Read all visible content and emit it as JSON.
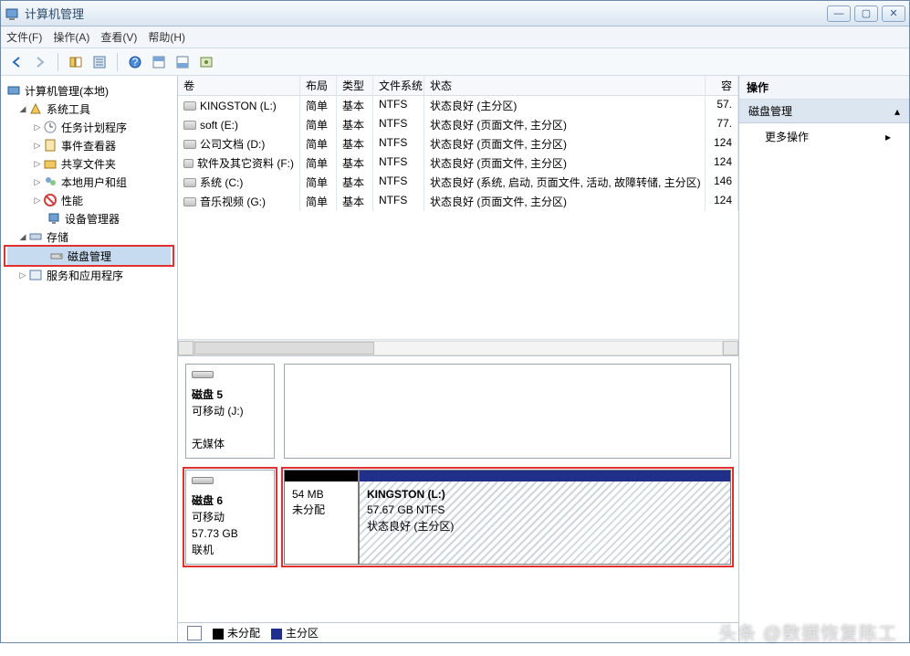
{
  "window": {
    "title": "计算机管理"
  },
  "menu": {
    "file": "文件(F)",
    "action": "操作(A)",
    "view": "查看(V)",
    "help": "帮助(H)"
  },
  "tree": {
    "root": "计算机管理(本地)",
    "system_tools": "系统工具",
    "task_scheduler": "任务计划程序",
    "event_viewer": "事件查看器",
    "shared_folders": "共享文件夹",
    "local_users": "本地用户和组",
    "performance": "性能",
    "device_manager": "设备管理器",
    "storage": "存储",
    "disk_management": "磁盘管理",
    "services": "服务和应用程序"
  },
  "columns": {
    "volume": "卷",
    "layout": "布局",
    "type": "类型",
    "fs": "文件系统",
    "status": "状态",
    "capacity": "容"
  },
  "volumes": [
    {
      "name": "KINGSTON (L:)",
      "layout": "简单",
      "type": "基本",
      "fs": "NTFS",
      "status": "状态良好 (主分区)",
      "cap": "57."
    },
    {
      "name": "soft (E:)",
      "layout": "简单",
      "type": "基本",
      "fs": "NTFS",
      "status": "状态良好 (页面文件, 主分区)",
      "cap": "77."
    },
    {
      "name": "公司文档 (D:)",
      "layout": "简单",
      "type": "基本",
      "fs": "NTFS",
      "status": "状态良好 (页面文件, 主分区)",
      "cap": "124"
    },
    {
      "name": "软件及其它资料 (F:)",
      "layout": "简单",
      "type": "基本",
      "fs": "NTFS",
      "status": "状态良好 (页面文件, 主分区)",
      "cap": "124"
    },
    {
      "name": "系统 (C:)",
      "layout": "简单",
      "type": "基本",
      "fs": "NTFS",
      "status": "状态良好 (系统, 启动, 页面文件, 活动, 故障转储, 主分区)",
      "cap": "146"
    },
    {
      "name": "音乐视频 (G:)",
      "layout": "简单",
      "type": "基本",
      "fs": "NTFS",
      "status": "状态良好 (页面文件, 主分区)",
      "cap": "124"
    }
  ],
  "disk5": {
    "title": "磁盘 5",
    "line1": "可移动 (J:)",
    "line2": "无媒体"
  },
  "disk6": {
    "title": "磁盘 6",
    "line1": "可移动",
    "line2": "57.73 GB",
    "line3": "联机",
    "part1": {
      "size": "54 MB",
      "status": "未分配"
    },
    "part2": {
      "name": "KINGSTON  (L:)",
      "size": "57.67 GB NTFS",
      "status": "状态良好 (主分区)"
    }
  },
  "legend": {
    "unallocated": "未分配",
    "primary": "主分区"
  },
  "actions": {
    "title": "操作",
    "group": "磁盘管理",
    "more": "更多操作"
  },
  "watermark": "头条 @数据恢复陈工",
  "colors": {
    "unallocated": "#000000",
    "primary": "#1f2f8a"
  }
}
